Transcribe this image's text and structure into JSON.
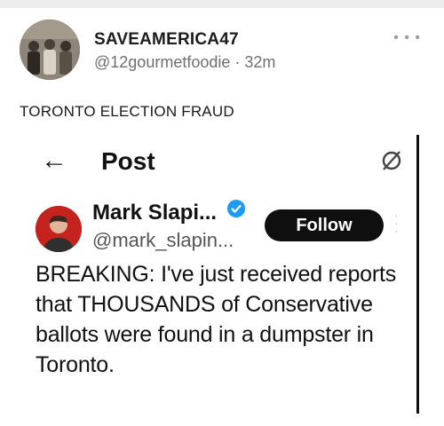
{
  "post": {
    "author_name": "SAVEAMERICA47",
    "author_handle": "@12gourmetfoodie",
    "separator": "·",
    "time_ago": "32m",
    "more_icon": "more-horizontal-icon",
    "text": "TORONTO ELECTION FRAUD"
  },
  "embed": {
    "back_icon": "arrow-left-icon",
    "header_title": "Post",
    "corner_icon": "refresh-icon",
    "author_name": "Mark Slapi...",
    "verified_icon": "verified-badge-icon",
    "handle": "@mark_slapin...",
    "follow_label": "Follow",
    "tweet_text": "BREAKING: I've just received reports that THOUSANDS of Conservative ballots were found in a dumpster in Toronto.",
    "colors": {
      "verified_blue": "#1d9bf0",
      "follow_bg": "#0f0f0f"
    }
  }
}
